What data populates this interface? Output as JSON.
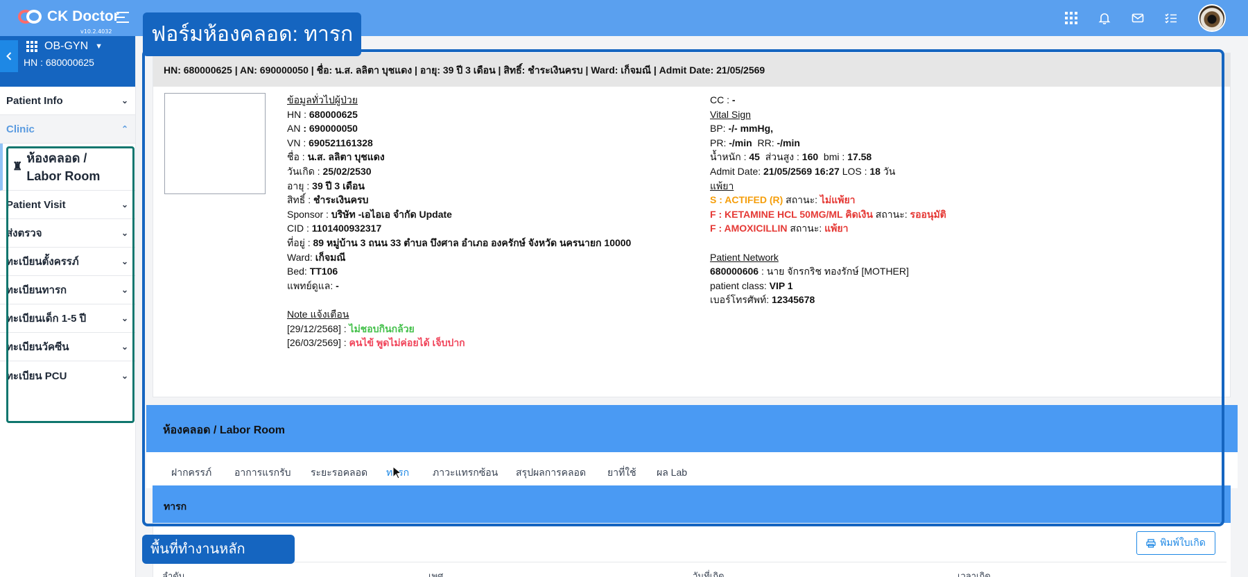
{
  "app": {
    "name": "CK Doctor",
    "version": "v10.2.4032"
  },
  "sidebar": {
    "department": "OB-GYN",
    "hn": "HN : 680000625",
    "items": [
      {
        "label": "Patient Info"
      },
      {
        "label": "Clinic"
      },
      {
        "label": "ห้องคลอด / Labor Room"
      },
      {
        "label": "Patient Visit"
      },
      {
        "label": "ส่งตรวจ"
      },
      {
        "label": "ทะเบียนตั้งครรภ์"
      },
      {
        "label": "ทะเบียนทารก"
      },
      {
        "label": "ทะเบียนเด็ก 1-5 ปี"
      },
      {
        "label": "ทะเบียนวัคซีน"
      },
      {
        "label": "ทะเบียน PCU"
      }
    ]
  },
  "annotations": {
    "form_title": "ฟอร์มห้องคลอด: ทารก",
    "workspace": "พื้นที่ทำงานหลัก"
  },
  "patient": {
    "header": "HN: 680000625 | AN: 690000050 | ชื่อ: น.ส. ลลิตา บุชแดง | อายุ: 39 ปี 3 เดือน | สิทธิ์: ชำระเงินครบ | Ward: เก็จมณี | Admit Date: 21/05/2569",
    "general_title": "ข้อมูลทั่วไปผู้ป่วย",
    "hn_label": "HN : ",
    "hn": "680000625",
    "an_label": "AN ",
    "an": ": 690000050",
    "vn_label": "VN : ",
    "vn": "690521161328",
    "name_label": "ชื่อ : ",
    "name": "น.ส. ลลิตา บุชแดง",
    "dob_label": "วันเกิด : ",
    "dob": "25/02/2530",
    "age_label": "อายุ : ",
    "age": "39 ปี 3 เดือน",
    "right_label": "สิทธิ์ : ",
    "right": "ชำระเงินครบ",
    "sponsor_label": "Sponsor : ",
    "sponsor": "บริษัท -เอไอเอ จำกัด Update",
    "cid_label": "CID : ",
    "cid": "1101400932317",
    "address_label": "ที่อยู่ : ",
    "address": "89 หมู่บ้าน 3 ถนน 33 ตำบล บึงศาล อำเภอ องครักษ์ จังหวัด นครนายก 10000",
    "ward_label": "Ward: ",
    "ward": "เก็จมณี",
    "bed_label": "Bed: ",
    "bed": "TT106",
    "doctor_label": "แพทย์ดูแล: ",
    "doctor": "-",
    "note_title": "Note แจ้งเตือน",
    "notes": [
      {
        "date": "[29/12/2568] : ",
        "text": "ไม่ชอบกินกล้วย"
      },
      {
        "date": "[26/03/2569] : ",
        "text": "คนไข้ พูดไม่ค่อยได้ เจ็บปาก"
      }
    ],
    "cc_label": "CC : ",
    "cc": "-",
    "vital_title": "Vital Sign",
    "bp_label": "BP: ",
    "bp": "-/- mmHg,",
    "pr_label": "PR: ",
    "pr": "-/min",
    "rr_label": "RR: ",
    "rr": "-/min",
    "weight_label": "น้ำหนัก : ",
    "weight": "45",
    "height_label": "ส่วนสูง : ",
    "height": "160",
    "bmi_label": "bmi : ",
    "bmi": "17.58",
    "admit_label": "Admit Date: ",
    "admit": "21/05/2569 16:27",
    "los_label": "LOS : ",
    "los": "18",
    "los_unit": "วัน",
    "allergy_title": "แพ้ยา",
    "allergies": [
      {
        "code": "S : ",
        "drug": "ACTIFED (R)",
        "status_label": " สถานะ: ",
        "status": "ไม่แพ้ยา"
      },
      {
        "code": "F : ",
        "drug": "KETAMINE HCL 50MG/ML คิดเงิน",
        "status_label": " สถานะ: ",
        "status": "รออนุมัติ"
      },
      {
        "code": "F : ",
        "drug": "AMOXICILLIN",
        "status_label": " สถานะ: ",
        "status": "แพ้ยา"
      }
    ],
    "network_title": "Patient Network",
    "network_hn": "680000606",
    "network_person": " : นาย จักรกริช ทองรักษ์ [MOTHER]",
    "class_label": "patient class: ",
    "class": "VIP 1",
    "phone_label": "เบอร์โทรศัพท์: ",
    "phone": "12345678"
  },
  "labor": {
    "title": "ห้องคลอด / Labor Room",
    "tabs": [
      "ฝากครรภ์",
      "อาการแรกรับ",
      "ระยะรอคลอด",
      "ทารก",
      "ภาวะแทรกซ้อน",
      "สรุปผลการคลอด",
      "ยาที่ใช้",
      "ผล Lab"
    ],
    "active_tab": "ทารก",
    "section_title": "ทารก",
    "print_button": "พิมพ์ใบเกิด",
    "columns": [
      "ลำดับ",
      "เพศ",
      "วันที่เกิด",
      "เวลาเกิด"
    ]
  },
  "colors": {
    "topbar": "#5aa0ef",
    "brand_dark": "#1565c0",
    "accent_bar": "#4a9af3",
    "highlight_box": "#0f766e"
  }
}
